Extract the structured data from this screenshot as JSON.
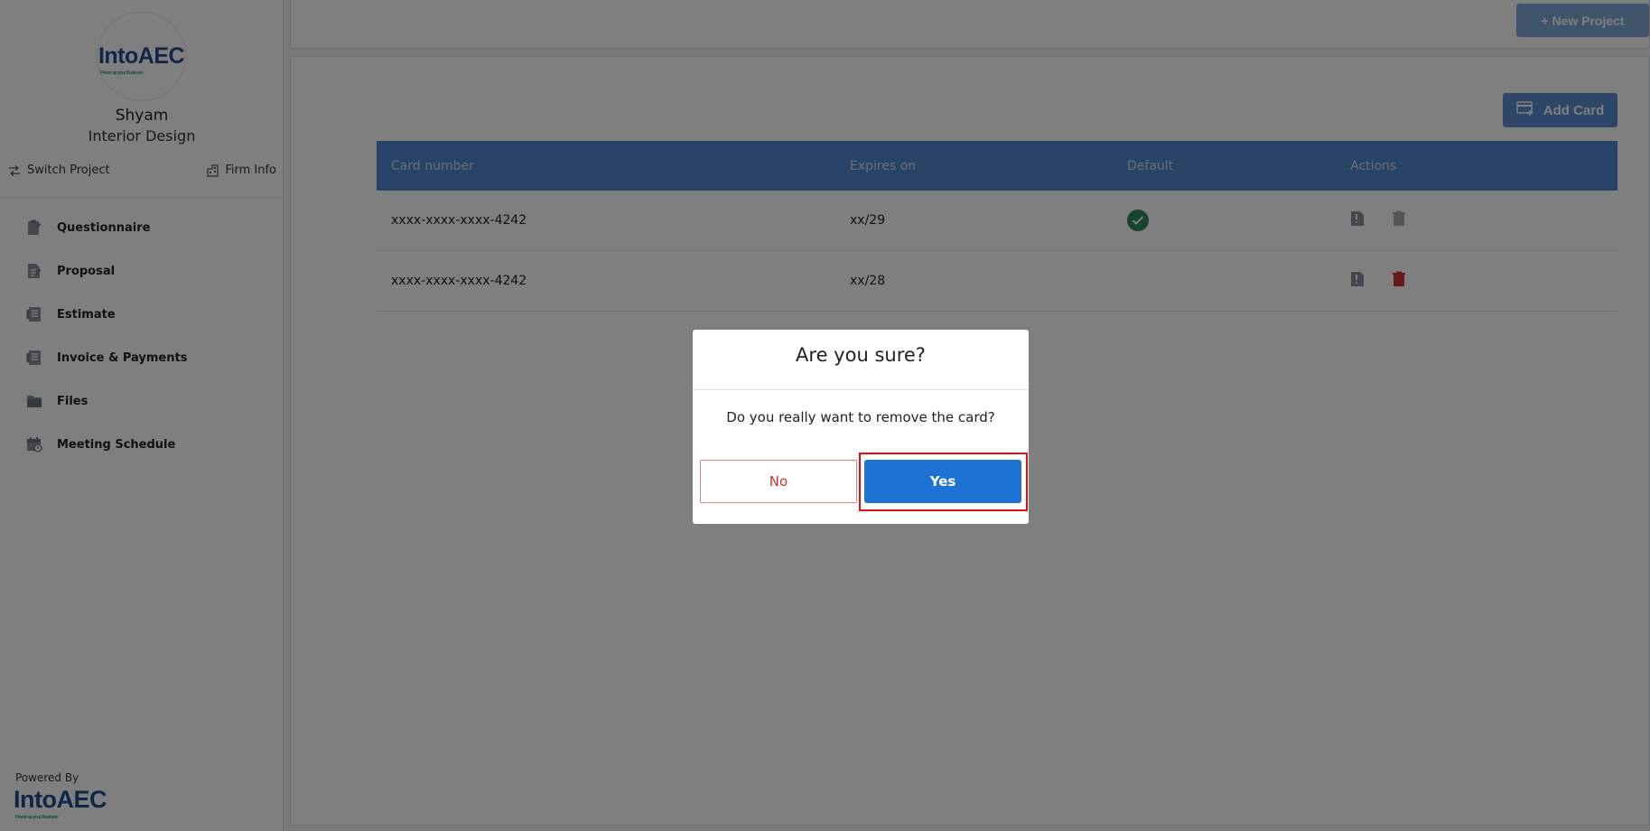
{
  "sidebar": {
    "logo_text_main": "Into",
    "logo_text_accent": "AEC",
    "logo_tagline": "Power up your Business",
    "user_name": "Shyam",
    "user_role": "Interior Design",
    "switch_project_label": "Switch Project",
    "firm_info_label": "Firm Info",
    "nav_items": [
      {
        "label": "Questionnaire",
        "icon": "questionnaire-icon"
      },
      {
        "label": "Proposal",
        "icon": "proposal-icon"
      },
      {
        "label": "Estimate",
        "icon": "estimate-icon"
      },
      {
        "label": "Invoice & Payments",
        "icon": "invoice-icon"
      },
      {
        "label": "Files",
        "icon": "folder-icon"
      },
      {
        "label": "Meeting Schedule",
        "icon": "calendar-icon"
      }
    ],
    "powered_by_label": "Powered By"
  },
  "header": {
    "new_project_label": "+ New Project"
  },
  "cards": {
    "add_card_label": "Add Card",
    "columns": [
      "Card number",
      "Expires on",
      "Default",
      "Actions"
    ],
    "rows": [
      {
        "card_number": "xxxx-xxxx-xxxx-4242",
        "expires_on": "xx/29",
        "is_default": true
      },
      {
        "card_number": "xxxx-xxxx-xxxx-4242",
        "expires_on": "xx/28",
        "is_default": false
      }
    ]
  },
  "dialog": {
    "title": "Are you sure?",
    "message": "Do you really want to remove the card?",
    "no_label": "No",
    "yes_label": "Yes"
  },
  "colors": {
    "primary": "#1e73d2",
    "table_header": "#4f86cb",
    "delete_red": "#d32f2f",
    "default_green": "#2e8b57",
    "highlight": "#e01010"
  }
}
